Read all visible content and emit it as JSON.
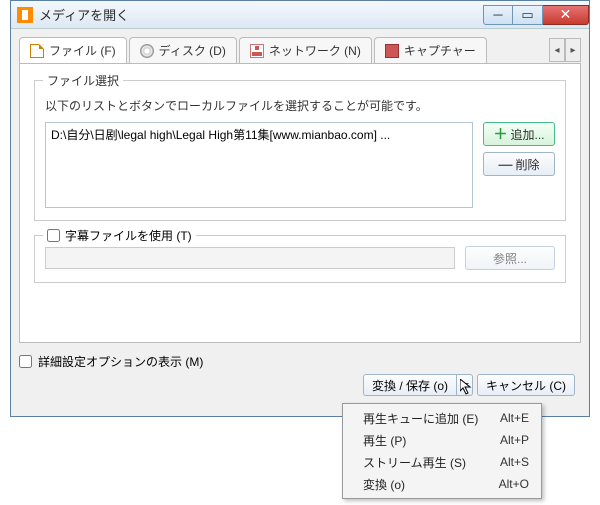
{
  "window": {
    "title": "メディアを開く"
  },
  "tabs": {
    "file": {
      "label": "ファイル (F)",
      "underline": "F"
    },
    "disc": {
      "label": "ディスク (D)"
    },
    "network": {
      "label": "ネットワーク (N)"
    },
    "capture": {
      "label": "キャプチャー"
    }
  },
  "file_section": {
    "legend": "ファイル選択",
    "description": "以下のリストとボタンでローカルファイルを選択することが可能です。",
    "items": [
      "D:\\自分\\日剧\\legal high\\Legal High第11集[www.mianbao.com] ..."
    ],
    "add_label": "追加...",
    "del_label": "削除"
  },
  "subtitle_section": {
    "checkbox_label": "字幕ファイルを使用 (T)",
    "path_value": "",
    "browse_label": "参照..."
  },
  "advanced": {
    "label": "詳細設定オプションの表示 (M)"
  },
  "actions": {
    "convert_save": "変換 / 保存 (o)",
    "cancel": "キャンセル (C)"
  },
  "menu": {
    "items": [
      {
        "label": "再生キューに追加 (E)",
        "shortcut": "Alt+E"
      },
      {
        "label": "再生 (P)",
        "shortcut": "Alt+P"
      },
      {
        "label": "ストリーム再生 (S)",
        "shortcut": "Alt+S"
      },
      {
        "label": "変換 (o)",
        "shortcut": "Alt+O"
      }
    ]
  }
}
